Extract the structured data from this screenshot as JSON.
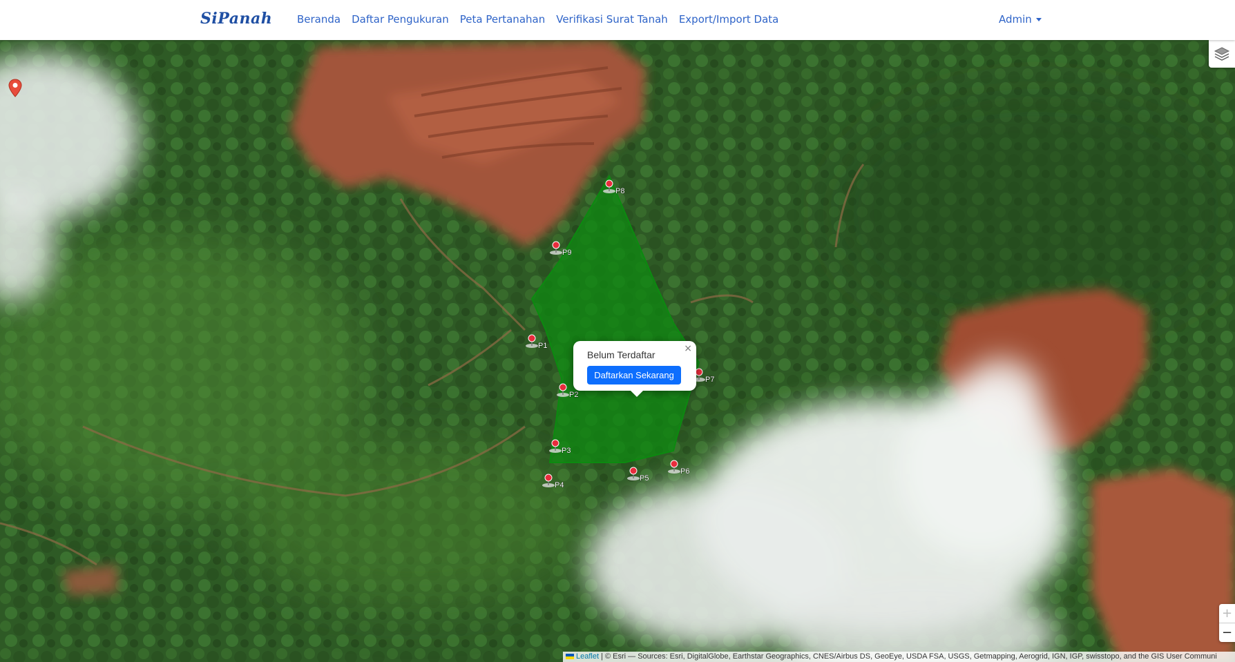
{
  "navbar": {
    "brand": "SiPanah",
    "links": [
      "Beranda",
      "Daftar Pengukuran",
      "Peta Pertanahan",
      "Verifikasi Surat Tanah",
      "Export/Import Data"
    ],
    "user": "Admin"
  },
  "map": {
    "layers_icon": "layers-icon",
    "location_icon": "map-pin-icon",
    "points": [
      {
        "label": "P1"
      },
      {
        "label": "P2"
      },
      {
        "label": "P3"
      },
      {
        "label": "P4"
      },
      {
        "label": "P5"
      },
      {
        "label": "P6"
      },
      {
        "label": "P7"
      },
      {
        "label": "P8"
      },
      {
        "label": "P9"
      }
    ],
    "polygon_color": "#0f8a12",
    "popup": {
      "title": "Belum Terdaftar",
      "button": "Daftarkan Sekarang",
      "close": "×"
    },
    "zoom": {
      "in": "+",
      "out": "−"
    },
    "attribution": {
      "leaflet": "Leaflet",
      "text": " | © Esri — Sources: Esri, DigitalGlobe, Earthstar Geographics, CNES/Airbus DS, GeoEye, USDA FSA, USGS, Getmapping, Aerogrid, IGN, IGP, swisstopo, and the GIS User Communi"
    }
  }
}
